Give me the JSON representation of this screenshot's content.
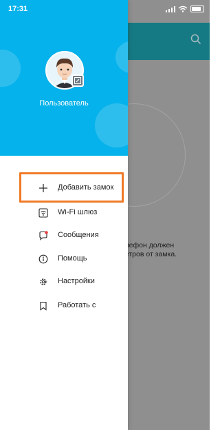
{
  "status_bar": {
    "time": "17:31",
    "battery_icon": "battery-icon"
  },
  "drawer": {
    "username": "Пользователь",
    "menu": {
      "add_lock": "Добавить замок",
      "wifi_gateway": "Wi-Fi шлюз",
      "messages": "Сообщения",
      "help": "Помощь",
      "settings": "Настройки",
      "work_with": "Работать с"
    }
  },
  "background": {
    "hint_line1": "елефон должен",
    "hint_line2": "иетров от замка."
  },
  "colors": {
    "drawer_header": "#06b2eb",
    "highlight": "#f07a27",
    "bg_header": "#167a84"
  }
}
